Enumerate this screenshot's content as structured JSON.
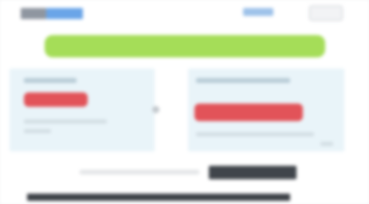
{
  "colors": {
    "hero_green": "#a5dd58",
    "cta_red": "#e25359",
    "panel_bg": "#e9f4f9",
    "dark_button": "#40454b",
    "link_blue": "#6aa5e8"
  },
  "header": {
    "logo_icon": "site-logo",
    "link_icon": "header-link",
    "button_icon": "header-button"
  },
  "hero": {
    "banner_icon": "green-banner"
  },
  "panels": [
    {
      "cta_icon": "red-button"
    },
    {
      "cta_icon": "red-button"
    }
  ],
  "bottom": {
    "button_icon": "dark-button"
  }
}
